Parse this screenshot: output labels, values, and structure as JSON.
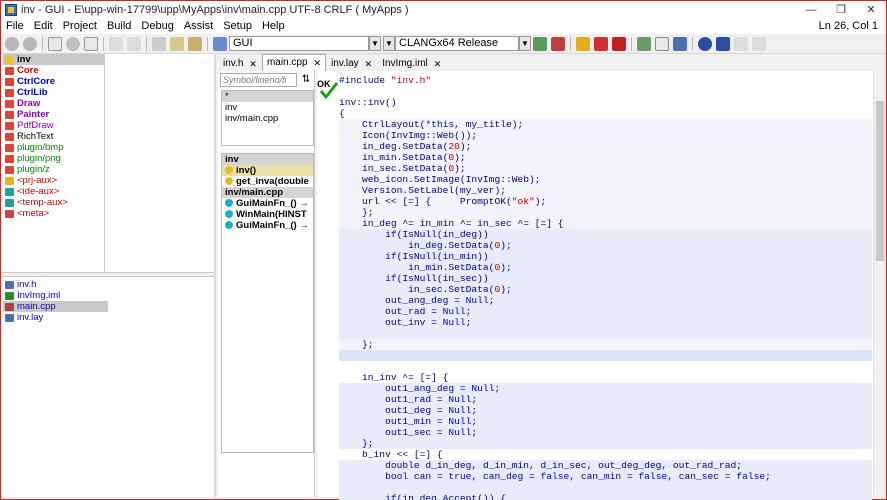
{
  "window": {
    "title": "inv - GUI - E\\upp-win-17799\\upp\\MyApps\\inv\\main.cpp UTF-8 CRLF ( MyApps )",
    "minimize": "—",
    "restore": "❐",
    "close": "✕"
  },
  "menu": {
    "items": [
      "File",
      "Edit",
      "Project",
      "Build",
      "Debug",
      "Assist",
      "Setup",
      "Help"
    ],
    "cursor_status": "Ln 26, Col 1"
  },
  "toolbar": {
    "main_config": "GUI",
    "build_method": "CLANGx64 Release"
  },
  "packages": [
    {
      "label": "inv",
      "color": "#000",
      "bold": true,
      "icon": "#f2c12e",
      "sel": true
    },
    {
      "label": "Core",
      "color": "#c00",
      "bold": true,
      "icon": "#d43"
    },
    {
      "label": "CtrlCore",
      "color": "#00c",
      "bold": true,
      "icon": "#d43"
    },
    {
      "label": "CtrlLib",
      "color": "#00c",
      "bold": true,
      "icon": "#d43"
    },
    {
      "label": "Draw",
      "color": "#80c",
      "bold": true,
      "icon": "#d43"
    },
    {
      "label": "Painter",
      "color": "#80c",
      "bold": true,
      "icon": "#d43"
    },
    {
      "label": "PdfDraw",
      "color": "#80c",
      "bold": false,
      "icon": "#d43"
    },
    {
      "label": "RichText",
      "color": "#000",
      "bold": false,
      "icon": "#d43"
    },
    {
      "label": "plugin/bmp",
      "color": "#080",
      "bold": false,
      "icon": "#d43"
    },
    {
      "label": "plugin/png",
      "color": "#080",
      "bold": false,
      "icon": "#d43"
    },
    {
      "label": "plugin/z",
      "color": "#080",
      "bold": false,
      "icon": "#d43"
    },
    {
      "label": "<prj-aux>",
      "color": "#c00",
      "bold": false,
      "icon": "#e8b020"
    },
    {
      "label": "<ide-aux>",
      "color": "#c00",
      "bold": false,
      "icon": "#20a0a0"
    },
    {
      "label": "<temp-aux>",
      "color": "#c00",
      "bold": false,
      "icon": "#20a0a0"
    },
    {
      "label": "<meta>",
      "color": "#c00",
      "bold": false,
      "icon": "#d04040"
    }
  ],
  "files": [
    {
      "label": "inv.h",
      "color": "#00c",
      "icon": "#4a6fb0"
    },
    {
      "label": "InvImg.iml",
      "color": "#00c",
      "icon": "#2a8a2a"
    },
    {
      "label": "main.cpp",
      "color": "#00c",
      "icon": "#b04040",
      "sel": true
    },
    {
      "label": "inv.lay",
      "color": "#00c",
      "icon": "#4a6fb0"
    }
  ],
  "navigator": {
    "search_placeholder": "Symbol/lineno/fi",
    "sort": "⇅",
    "scopes": [
      "*",
      "inv",
      "inv/main.cpp"
    ],
    "symbols_header": "inv",
    "symbols": [
      {
        "label": "inv()",
        "dot": "#e0c020",
        "sel": true
      },
      {
        "label": "get_inva(double",
        "dot": "#e0c020"
      },
      {
        "label": "inv/main.cpp",
        "hdr": true
      },
      {
        "label": "GuiMainFn_() →",
        "dot": "#20b0c0"
      },
      {
        "label": "WinMain(HINST",
        "dot": "#20b0c0"
      },
      {
        "label": "GuiMainFn_() →",
        "dot": "#20b0c0"
      }
    ]
  },
  "tabs": [
    {
      "label": "inv.h"
    },
    {
      "label": "main.cpp",
      "active": true
    },
    {
      "label": "inv.lay"
    },
    {
      "label": "InvImg.iml"
    }
  ],
  "editor": {
    "ok_label": "OK",
    "lines": [
      "#include \"inv.h\"",
      "",
      "inv::inv()",
      "{",
      "    CtrlLayout(*this, my_title);",
      "    Icon(InvImg::Web());",
      "    in_deg.SetData(20);",
      "    in_min.SetData(0);",
      "    in_sec.SetData(0);",
      "    web_icon.SetImage(InvImg::Web);",
      "    Version.SetLabel(my_ver);",
      "    url << [=] {     PromptOK(\"ok\");",
      "    };",
      "    in_deg ^= in_min ^= in_sec ^= [=] {",
      "        if(IsNull(in_deg))",
      "            in_deg.SetData(0);",
      "        if(IsNull(in_min))",
      "            in_min.SetData(0);",
      "        if(IsNull(in_sec))",
      "            in_sec.SetData(0);",
      "        out_ang_deg = Null;",
      "        out_rad = Null;",
      "        out_inv = Null;",
      "",
      "    };",
      "",
      "",
      "    in_inv ^= [=] {",
      "        out1_ang_deg = Null;",
      "        out1_rad = Null;",
      "        out1_deg = Null;",
      "        out1_min = Null;",
      "        out1_sec = Null;",
      "    };",
      "    b_inv << [=] {",
      "        double d_in_deg, d_in_min, d_in_sec, out_deg_deg, out_rad_rad;",
      "        bool can = true, can_deg = false, can_min = false, can_sec = false;",
      "",
      "        if(in_deg.Accept()) {"
    ],
    "current_line_index": 25
  }
}
